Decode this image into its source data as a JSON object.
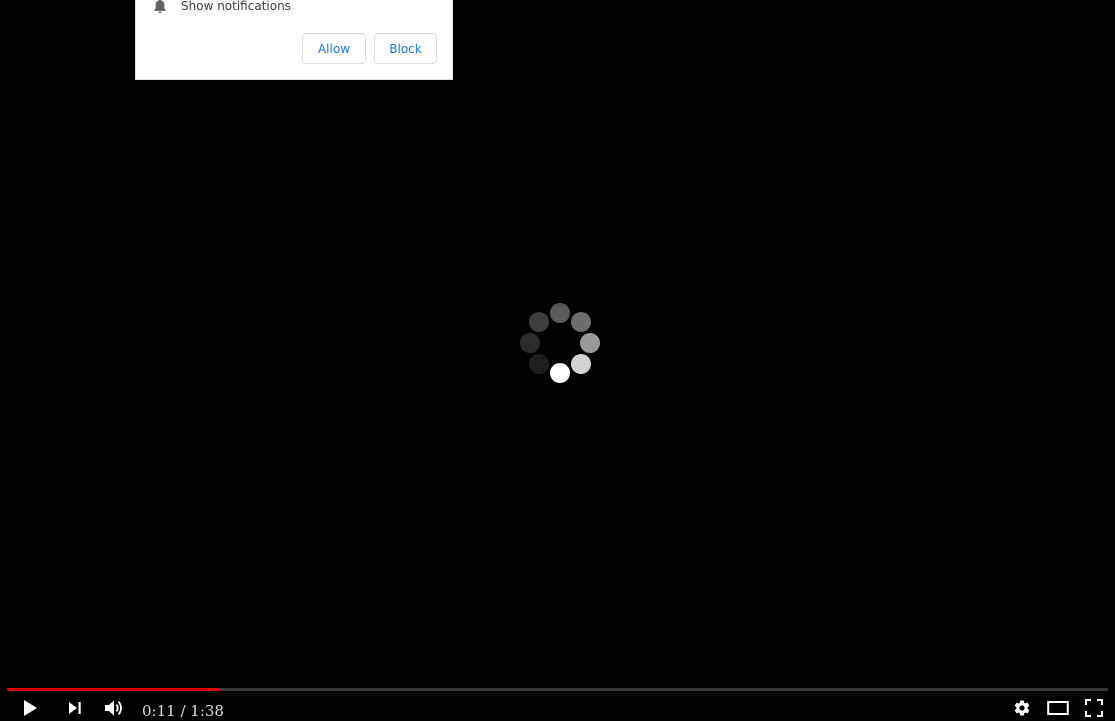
{
  "notification_popup": {
    "text": "Show notifications",
    "icon": "bell-icon",
    "allow_label": "Allow",
    "block_label": "Block",
    "button_text_color": "#1a73e8"
  },
  "spinner": {
    "icon": "loading-spinner-icon"
  },
  "player": {
    "current_time": "0:11",
    "separator": " / ",
    "duration": "1:38",
    "progress_fraction": 0.1939,
    "progress_color": "#e00000",
    "controls": {
      "play": "play-icon",
      "next": "next-icon",
      "volume": "volume-icon",
      "settings": "gear-icon",
      "theater": "theater-mode-icon",
      "fullscreen": "fullscreen-icon"
    }
  }
}
